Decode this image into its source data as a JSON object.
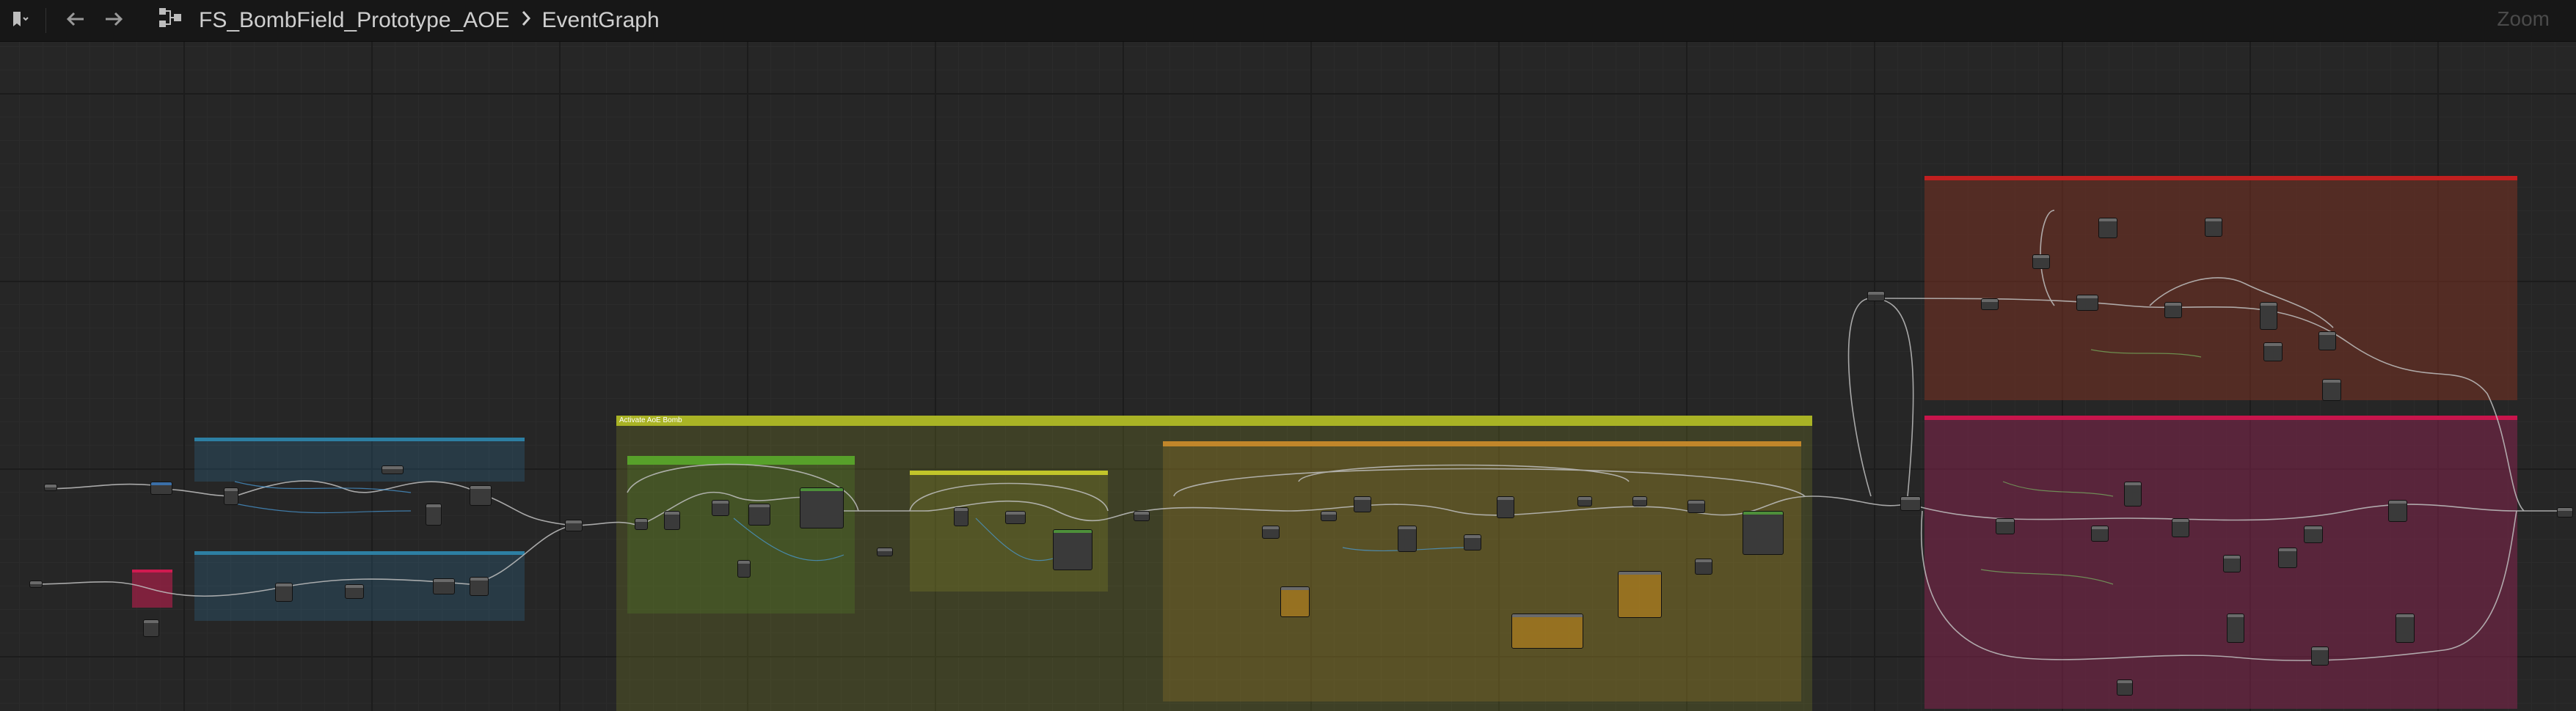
{
  "toolbar": {
    "bookmark_icon": "bookmark-icon",
    "back_icon": "arrow-left-icon",
    "forward_icon": "arrow-right-icon",
    "graph_icon": "blueprint-graph-icon",
    "breadcrumb": {
      "asset": "FS_BombField_Prototype_AOE",
      "separator_icon": "chevron-right-icon",
      "graph": "EventGraph"
    },
    "zoom_label": "Zoom"
  },
  "graph": {
    "comments": [
      {
        "id": "c1",
        "title": "",
        "color": "#2d7fa3"
      },
      {
        "id": "c2",
        "title": "",
        "color": "#2d7fa3"
      },
      {
        "id": "c3",
        "title": "Activate AoE Bomb",
        "color": "#a9b325"
      },
      {
        "id": "c4",
        "title": "",
        "color": "#57a02a"
      },
      {
        "id": "c5",
        "title": "",
        "color": "#a9b325"
      },
      {
        "id": "c6",
        "title": "",
        "color": "#c1862a"
      },
      {
        "id": "c7",
        "title": "",
        "color": "#c11f1f"
      },
      {
        "id": "c8",
        "title": "",
        "color": "#c8154c"
      }
    ],
    "colors": {
      "background": "#262626",
      "toolbar": "#171717",
      "wire_exec": "#bfbfbf",
      "wire_data": "#5aa0ff"
    }
  }
}
